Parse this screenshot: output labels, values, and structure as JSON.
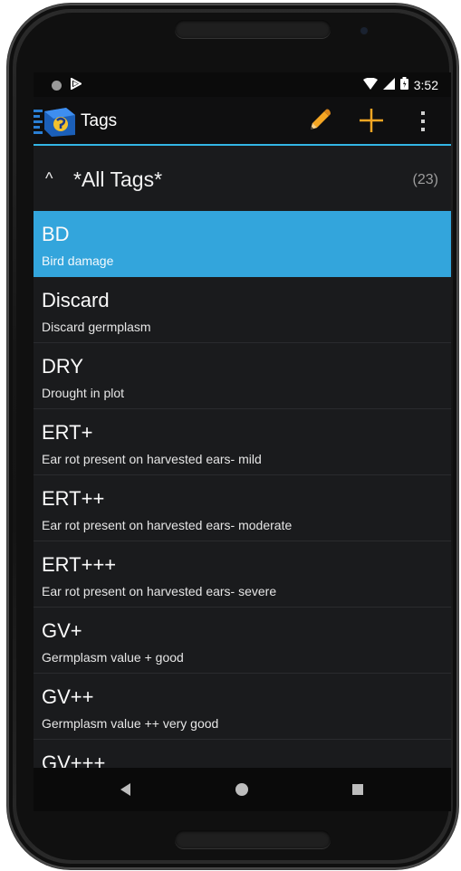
{
  "status_bar": {
    "time": "3:52",
    "icons": [
      "circle-notification-icon",
      "flag-notification-icon",
      "wifi-icon",
      "signal-icon",
      "battery-icon"
    ]
  },
  "action_bar": {
    "title": "Tags",
    "logo_icon": "app-logo-icon",
    "actions": [
      "edit-pencil-icon",
      "add-plus-icon",
      "overflow-menu-icon"
    ]
  },
  "group": {
    "chevron": "^",
    "title": "*All Tags*",
    "count": "(23)"
  },
  "tags": [
    {
      "name": "BD",
      "description": "Bird damage",
      "selected": true
    },
    {
      "name": "Discard",
      "description": "Discard germplasm",
      "selected": false
    },
    {
      "name": "DRY",
      "description": "Drought in plot",
      "selected": false
    },
    {
      "name": "ERT+",
      "description": "Ear rot present on harvested ears- mild",
      "selected": false
    },
    {
      "name": "ERT++",
      "description": "Ear rot present on harvested ears- moderate",
      "selected": false
    },
    {
      "name": "ERT+++",
      "description": "Ear rot present on harvested ears- severe",
      "selected": false
    },
    {
      "name": "GV+",
      "description": "Germplasm value + good",
      "selected": false
    },
    {
      "name": "GV++",
      "description": "Germplasm value ++ very good",
      "selected": false
    },
    {
      "name": "GV+++",
      "description": "",
      "selected": false
    }
  ],
  "nav_bar": {
    "icons": [
      "back-icon",
      "home-icon",
      "recents-icon"
    ]
  },
  "colors": {
    "accent": "#33b5e5",
    "selected_row": "#33a5dc",
    "action_icon": "#f5a623",
    "background": "#1a1b1d"
  }
}
